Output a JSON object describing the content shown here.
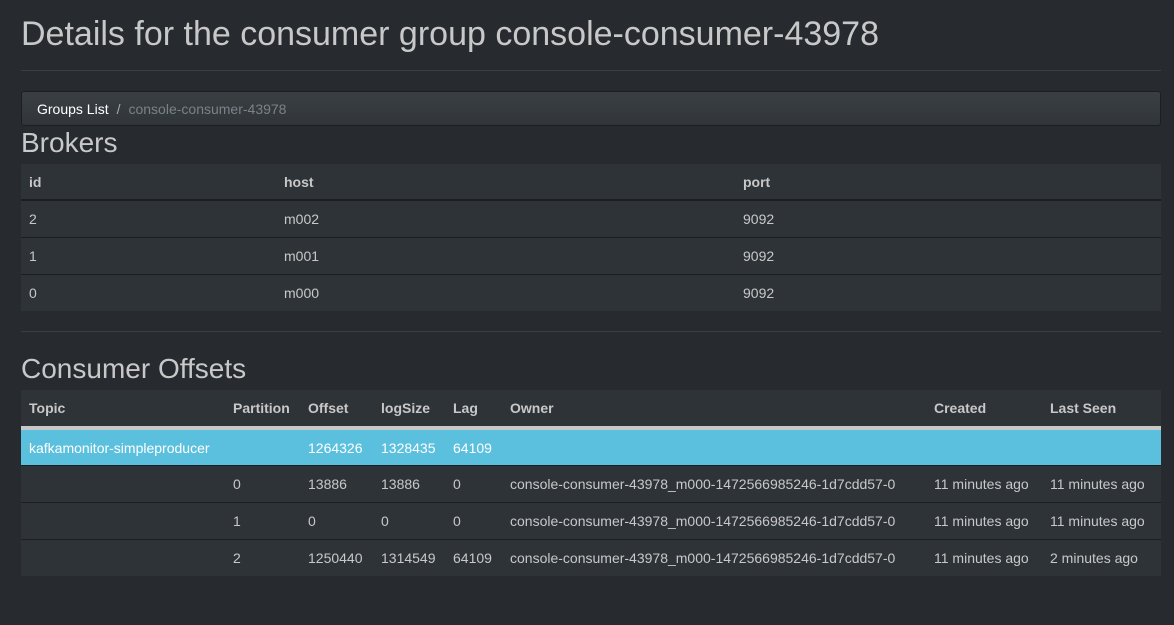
{
  "page": {
    "title": "Details for the consumer group console-consumer-43978"
  },
  "breadcrumb": {
    "groups_list": "Groups List",
    "separator": "/",
    "current": "console-consumer-43978"
  },
  "brokers": {
    "title": "Brokers",
    "columns": [
      "id",
      "host",
      "port"
    ],
    "rows": [
      [
        "2",
        "m002",
        "9092"
      ],
      [
        "1",
        "m001",
        "9092"
      ],
      [
        "0",
        "m000",
        "9092"
      ]
    ]
  },
  "offsets": {
    "title": "Consumer Offsets",
    "columns": [
      "Topic",
      "Partition",
      "Offset",
      "logSize",
      "Lag",
      "Owner",
      "Created",
      "Last Seen"
    ],
    "topic_row": [
      "kafkamonitor-simpleproducer",
      "",
      "1264326",
      "1328435",
      "64109",
      "",
      "",
      ""
    ],
    "rows": [
      [
        "",
        "0",
        "13886",
        "13886",
        "0",
        "console-consumer-43978_m000-1472566985246-1d7cdd57-0",
        "11 minutes ago",
        "11 minutes ago"
      ],
      [
        "",
        "1",
        "0",
        "0",
        "0",
        "console-consumer-43978_m000-1472566985246-1d7cdd57-0",
        "11 minutes ago",
        "11 minutes ago"
      ],
      [
        "",
        "2",
        "1250440",
        "1314549",
        "64109",
        "console-consumer-43978_m000-1472566985246-1d7cdd57-0",
        "11 minutes ago",
        "2 minutes ago"
      ]
    ]
  },
  "colors": {
    "background": "#272b30",
    "table_bg": "#2e3338",
    "highlight": "#5bc0de",
    "text": "#c8c8c8"
  }
}
